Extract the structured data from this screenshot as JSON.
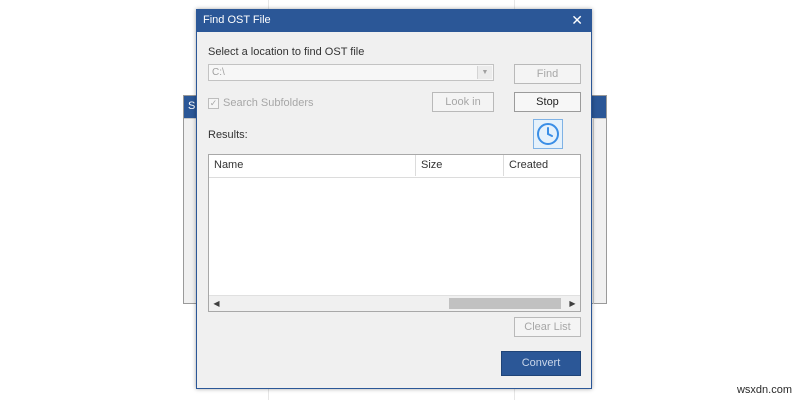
{
  "background_window": {
    "title_fragment": "S"
  },
  "dialog": {
    "title": "Find OST File",
    "close_glyph": "✕",
    "location_label": "Select a location to find OST file",
    "path_value": "C:\\",
    "find_label": "Find",
    "search_subfolders_label": "Search Subfolders",
    "search_subfolders_checked": true,
    "look_in_label": "Look in",
    "stop_label": "Stop",
    "results_label": "Results:",
    "schedule_icon": "clock-icon",
    "table": {
      "columns": [
        "Name",
        "Size",
        "Created"
      ],
      "rows": []
    },
    "clear_list_label": "Clear List",
    "convert_label": "Convert"
  },
  "watermark": "wsxdn.com",
  "colors": {
    "title_bar": "#2b5797",
    "dialog_bg": "#f0f0f0",
    "disabled_text": "#a7a7a7",
    "clock_accent": "#3a8ee6"
  }
}
